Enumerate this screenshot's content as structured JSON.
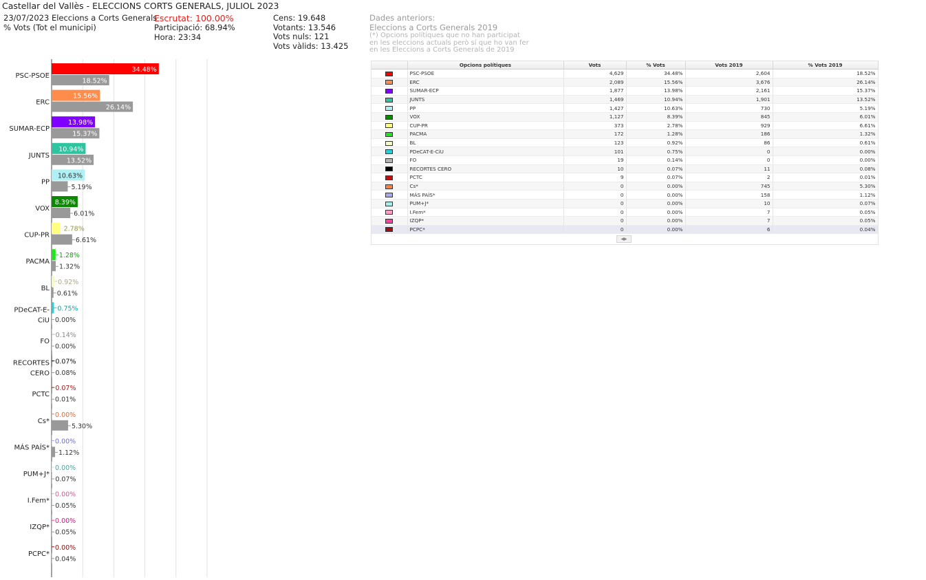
{
  "header": {
    "title": "Castellar del Vallès - ELECCIONS CORTS GENERALS, JULIOL 2023",
    "election_line": "23/07/2023 Eleccions a Corts Generals",
    "scope": "% Vots (Tot el municipi)",
    "escrutat": "Escrutat: 100.00%",
    "participacio": "Participació: 68.94%",
    "hora": "Hora: 23:34",
    "cens": "Cens: 19.648",
    "votants": "Votants: 13.546",
    "nuls": "Vots nuls: 121",
    "valids": "Vots vàlids: 13.425",
    "prev_title": "Dades anteriors:",
    "prev_election": "Eleccions a Corts Generals 2019",
    "note_1": "(*) Opcions polítiques que no han participat",
    "note_2": "en les eleccions actuals però sí que ho van fer",
    "note_3": "en les Eleccions a Corts Generals de 2019"
  },
  "table": {
    "headers": [
      "",
      "Opcions polítiques",
      "Vots",
      "% Vots",
      "Vots 2019",
      "% Vots 2019"
    ],
    "rows": [
      {
        "party": "PSC-PSOE",
        "color": "#ff0000",
        "votes": "4,629",
        "pct": "34.48%",
        "votes_2019": "2,604",
        "pct_2019": "18.52%"
      },
      {
        "party": "ERC",
        "color": "#ff8c4a",
        "votes": "2,089",
        "pct": "15.56%",
        "votes_2019": "3,676",
        "pct_2019": "26.14%"
      },
      {
        "party": "SUMAR-ECP",
        "color": "#8000ff",
        "votes": "1,877",
        "pct": "13.98%",
        "votes_2019": "2,161",
        "pct_2019": "15.37%"
      },
      {
        "party": "JUNTS",
        "color": "#2fc4a0",
        "votes": "1,469",
        "pct": "10.94%",
        "votes_2019": "1,901",
        "pct_2019": "13.52%"
      },
      {
        "party": "PP",
        "color": "#aef0f4",
        "votes": "1,427",
        "pct": "10.63%",
        "votes_2019": "730",
        "pct_2019": "5.19%"
      },
      {
        "party": "VOX",
        "color": "#0b8a00",
        "votes": "1,127",
        "pct": "8.39%",
        "votes_2019": "845",
        "pct_2019": "6.01%"
      },
      {
        "party": "CUP-PR",
        "color": "#ffff80",
        "votes": "373",
        "pct": "2.78%",
        "votes_2019": "929",
        "pct_2019": "6.61%"
      },
      {
        "party": "PACMA",
        "color": "#1ee51e",
        "votes": "172",
        "pct": "1.28%",
        "votes_2019": "186",
        "pct_2019": "1.32%"
      },
      {
        "party": "BL",
        "color": "#f4f9c8",
        "votes": "123",
        "pct": "0.92%",
        "votes_2019": "86",
        "pct_2019": "0.61%"
      },
      {
        "party": "PDeCAT-E-CiU",
        "color": "#24d0d8",
        "votes": "101",
        "pct": "0.75%",
        "votes_2019": "0",
        "pct_2019": "0.00%"
      },
      {
        "party": "FO",
        "color": "#b4b4b4",
        "votes": "19",
        "pct": "0.14%",
        "votes_2019": "0",
        "pct_2019": "0.00%"
      },
      {
        "party": "RECORTES CERO",
        "color": "#000000",
        "votes": "10",
        "pct": "0.07%",
        "votes_2019": "11",
        "pct_2019": "0.08%"
      },
      {
        "party": "PCTC",
        "color": "#c01010",
        "votes": "9",
        "pct": "0.07%",
        "votes_2019": "2",
        "pct_2019": "0.01%"
      },
      {
        "party": "Cs*",
        "color": "#ff8040",
        "votes": "0",
        "pct": "0.00%",
        "votes_2019": "745",
        "pct_2019": "5.30%"
      },
      {
        "party": "MÁS PAÍS*",
        "color": "#a8a8ee",
        "votes": "0",
        "pct": "0.00%",
        "votes_2019": "158",
        "pct_2019": "1.12%"
      },
      {
        "party": "PUM+J*",
        "color": "#a8ecec",
        "votes": "0",
        "pct": "0.00%",
        "votes_2019": "10",
        "pct_2019": "0.07%"
      },
      {
        "party": "I.Fem*",
        "color": "#ff9fc8",
        "votes": "0",
        "pct": "0.00%",
        "votes_2019": "7",
        "pct_2019": "0.05%"
      },
      {
        "party": "IZQP*",
        "color": "#ff40a0",
        "votes": "0",
        "pct": "0.00%",
        "votes_2019": "7",
        "pct_2019": "0.05%"
      },
      {
        "party": "PCPC*",
        "color": "#a01010",
        "votes": "0",
        "pct": "0.00%",
        "votes_2019": "6",
        "pct_2019": "0.04%"
      }
    ]
  },
  "chart_data": {
    "type": "bar",
    "orientation": "horizontal",
    "categories": [
      "PSC-PSOE",
      "ERC",
      "SUMAR-ECP",
      "JUNTS",
      "PP",
      "VOX",
      "CUP-PR",
      "PACMA",
      "BL",
      "PDeCAT-E-CiU",
      "FO",
      "RECORTES CERO",
      "PCTC",
      "Cs*",
      "MÁS PAÍS*",
      "PUM+J*",
      "I.Fem*",
      "IZQP*",
      "PCPC*"
    ],
    "category_lines": [
      [
        "PSC-PSOE"
      ],
      [
        "ERC"
      ],
      [
        "SUMAR-ECP"
      ],
      [
        "JUNTS"
      ],
      [
        "PP"
      ],
      [
        "VOX"
      ],
      [
        "CUP-PR"
      ],
      [
        "PACMA"
      ],
      [
        "BL"
      ],
      [
        "PDeCAT-E-",
        "CiU"
      ],
      [
        "FO"
      ],
      [
        "RECORTES",
        "CERO"
      ],
      [
        "PCTC"
      ],
      [
        "Cs*"
      ],
      [
        "MÁS PAÍS*"
      ],
      [
        "PUM+J*"
      ],
      [
        "I.Fem*"
      ],
      [
        "IZQP*"
      ],
      [
        "PCPC*"
      ]
    ],
    "series": [
      {
        "values": [
          34.48,
          15.56,
          13.98,
          10.94,
          10.63,
          8.39,
          2.78,
          1.28,
          0.92,
          0.75,
          0.14,
          0.07,
          0.07,
          0,
          0,
          0,
          0,
          0,
          0
        ],
        "colors": [
          "#ff0000",
          "#ff8c4a",
          "#8000ff",
          "#2fc4a0",
          "#aef0f4",
          "#0b8a00",
          "#ffff80",
          "#1ee51e",
          "#f4f9c8",
          "#24d0d8",
          "#b4b4b4",
          "#000000",
          "#c01010",
          "#ff8040",
          "#a8a8ee",
          "#a8ecec",
          "#ff9fc8",
          "#ff40a0",
          "#a01010"
        ],
        "label_colors": [
          "#ffffff",
          "#ffffff",
          "#ffffff",
          "#ffffff",
          "#333333",
          "#ffffff",
          "#9a9a40",
          "#1a9a1a",
          "#a8a890",
          "#1a9aa0",
          "#888888",
          "#111111",
          "#a02020",
          "#d07040",
          "#7070c0",
          "#50a0a0",
          "#c06090",
          "#c02080",
          "#801010"
        ]
      },
      {
        "values": [
          18.52,
          26.14,
          15.37,
          13.52,
          5.19,
          6.01,
          6.61,
          1.32,
          0.61,
          0,
          0,
          0.08,
          0.01,
          5.3,
          1.12,
          0.07,
          0.05,
          0.05,
          0.04
        ],
        "color": "#999999"
      }
    ],
    "value_labels_current": [
      "34.48%",
      "15.56%",
      "13.98%",
      "10.94%",
      "10.63%",
      "8.39%",
      "2.78%",
      "1.28%",
      "0.92%",
      "0.75%",
      "0.14%",
      "0.07%",
      "0.07%",
      "0.00%",
      "0.00%",
      "0.00%",
      "0.00%",
      "0.00%",
      "0.00%"
    ],
    "value_labels_2019": [
      "18.52%",
      "26.14%",
      "15.37%",
      "13.52%",
      "5.19%",
      "6.01%",
      "6.61%",
      "1.32%",
      "0.61%",
      "0.00%",
      "0.00%",
      "0.08%",
      "0.01%",
      "5.30%",
      "1.12%",
      "0.07%",
      "0.05%",
      "0.05%",
      "0.04%"
    ],
    "xlim": [
      0,
      50
    ],
    "grid": true
  }
}
